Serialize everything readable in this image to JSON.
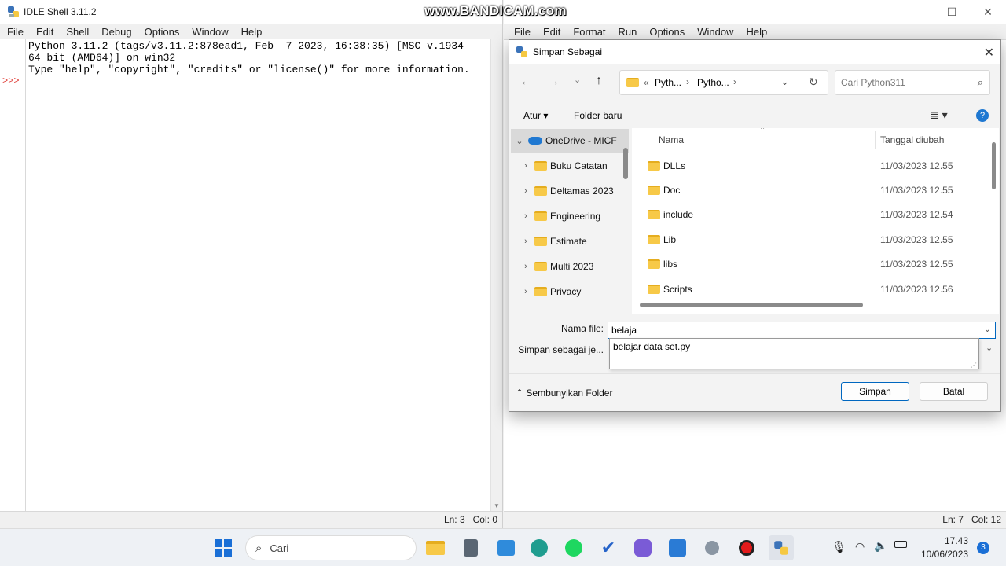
{
  "shell": {
    "title": "IDLE Shell 3.11.2",
    "menu": [
      "File",
      "Edit",
      "Shell",
      "Debug",
      "Options",
      "Window",
      "Help"
    ],
    "lines": [
      "Python 3.11.2 (tags/v3.11.2:878ead1, Feb  7 2023, 16:38:35) [MSC v.1934",
      "64 bit (AMD64)] on win32",
      "Type \"help\", \"copyright\", \"credits\" or \"license()\" for more information."
    ],
    "prompt": ">>>",
    "status_ln": "Ln: 3",
    "status_col": "Col: 0"
  },
  "editor": {
    "menu": [
      "File",
      "Edit",
      "Format",
      "Run",
      "Options",
      "Window",
      "Help"
    ],
    "status_ln": "Ln: 7",
    "status_col": "Col: 12"
  },
  "watermark": "www.BANDICAM.com",
  "dialog": {
    "title": "Simpan Sebagai",
    "breadcrumb": [
      "Pyth...",
      "Pytho..."
    ],
    "breadcrumb_prefix": "«",
    "search_placeholder": "Cari Python311",
    "organize": "Atur",
    "new_folder": "Folder baru",
    "nav_items": [
      "OneDrive - MICF",
      "Buku Catatan",
      "Deltamas 2023",
      "Engineering",
      "Estimate",
      "Multi 2023",
      "Privacy"
    ],
    "col_name": "Nama",
    "col_date": "Tanggal diubah",
    "files": [
      {
        "name": "DLLs",
        "date": "11/03/2023 12.55"
      },
      {
        "name": "Doc",
        "date": "11/03/2023 12.55"
      },
      {
        "name": "include",
        "date": "11/03/2023 12.54"
      },
      {
        "name": "Lib",
        "date": "11/03/2023 12.55"
      },
      {
        "name": "libs",
        "date": "11/03/2023 12.55"
      },
      {
        "name": "Scripts",
        "date": "11/03/2023 12.56"
      }
    ],
    "filename_label": "Nama file:",
    "filename_value": "belaja",
    "filetype_label": "Simpan sebagai je...",
    "suggestion": "belajar data set.py",
    "hide_folders": "Sembunyikan Folder",
    "save": "Simpan",
    "cancel": "Batal"
  },
  "taskbar": {
    "search_placeholder": "Cari",
    "time": "17.43",
    "date": "10/06/2023",
    "notification_count": "3"
  }
}
